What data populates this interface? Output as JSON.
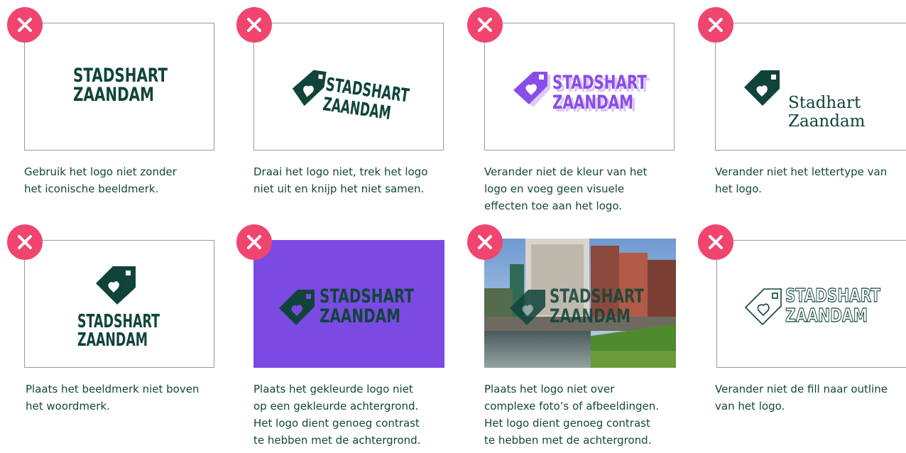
{
  "colors": {
    "dark_green": "#10443a",
    "badge_pink": "#f0456f",
    "purple": "#7b4ae2",
    "caption_text": "#13463a"
  },
  "icons": {
    "badge": "close-x-icon",
    "mark": "tag-heart-icon"
  },
  "logo_text": {
    "line1": "STADSHART",
    "line2": "ZAANDAM"
  },
  "serif_logo_text": {
    "line1": "Stadhart",
    "line2": "Zaandam"
  },
  "cards": [
    {
      "caption": [
        "Gebruik het logo niet zonder",
        "het iconische beeldmerk."
      ]
    },
    {
      "caption": [
        "Draai het logo niet, trek het logo",
        "niet uit en knijp het niet samen."
      ]
    },
    {
      "caption": [
        "Verander niet de kleur van het",
        "logo en voeg geen visuele",
        "effecten toe aan het logo."
      ]
    },
    {
      "caption": [
        "Verander niet het lettertype van",
        "het logo."
      ]
    },
    {
      "caption": [
        "Plaats het beeldmerk niet boven",
        "het woordmerk."
      ]
    },
    {
      "caption": [
        "Plaats het gekleurde logo niet",
        "op een gekleurde achtergrond.",
        "Het logo dient genoeg contrast",
        "te hebben met de achtergrond."
      ]
    },
    {
      "caption": [
        "Plaats het logo niet over",
        "complexe foto’s of afbeeldingen.",
        "Het logo dient genoeg contrast",
        "te hebben met de achtergrond."
      ]
    },
    {
      "caption": [
        "Verander niet de fill naar outline",
        "van het logo."
      ]
    }
  ]
}
